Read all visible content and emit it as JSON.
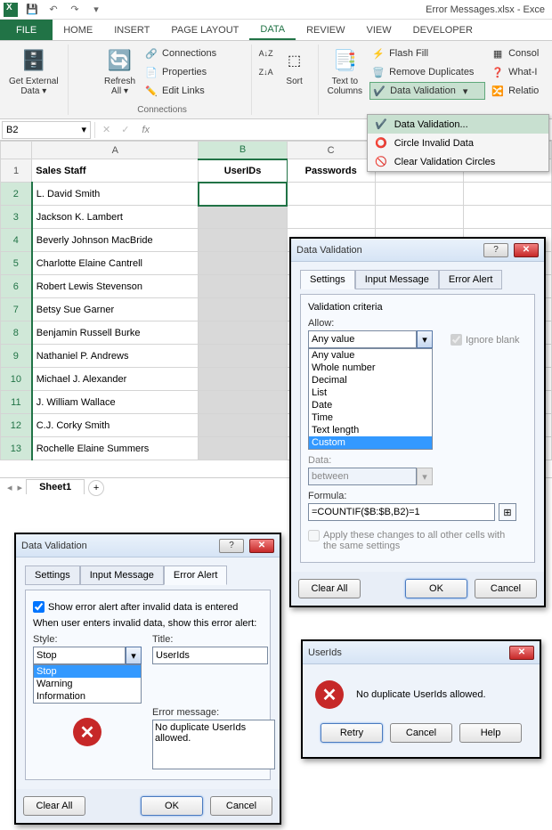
{
  "app": {
    "title": "Error Messages.xlsx - Exce"
  },
  "qat": {
    "save": "💾",
    "undo": "↶",
    "redo": "↷"
  },
  "tabs": {
    "file": "FILE",
    "home": "HOME",
    "insert": "INSERT",
    "pagelayout": "PAGE LAYOUT",
    "data": "DATA",
    "review": "REVIEW",
    "view": "VIEW",
    "developer": "DEVELOPER"
  },
  "ribbon": {
    "getexternal": "Get External\nData ▾",
    "refresh": "Refresh\nAll ▾",
    "connections_group": "Connections",
    "connections": "Connections",
    "properties": "Properties",
    "editlinks": "Edit Links",
    "sort": "Sort",
    "texttocol": "Text to\nColumns",
    "flashfill": "Flash Fill",
    "removedup": "Remove Duplicates",
    "datavalidation": "Data Validation",
    "consol": "Consol",
    "whatif": "What-I",
    "relation": "Relatio"
  },
  "dvmenu": {
    "dv": "Data Validation...",
    "circle": "Circle Invalid Data",
    "clear": "Clear Validation Circles"
  },
  "namebox": "B2",
  "sheet": {
    "headers": {
      "A": "Sales Staff",
      "B": "UserIDs",
      "C": "Passwords"
    },
    "rows": [
      "L. David Smith",
      "Jackson K. Lambert",
      "Beverly Johnson MacBride",
      "Charlotte Elaine Cantrell",
      "Robert Lewis Stevenson",
      "Betsy Sue Garner",
      "Benjamin Russell Burke",
      "Nathaniel P. Andrews",
      "Michael J. Alexander",
      "J. William Wallace",
      "C.J. Corky Smith",
      "Rochelle Elaine Summers"
    ],
    "tabname": "Sheet1"
  },
  "dlgSettings": {
    "title": "Data Validation",
    "tabs": {
      "settings": "Settings",
      "inputmsg": "Input Message",
      "erroralert": "Error Alert"
    },
    "criteria": "Validation criteria",
    "allow": "Allow:",
    "ignoreblank": "Ignore blank",
    "allow_value": "Any value",
    "options": [
      "Any value",
      "Whole number",
      "Decimal",
      "List",
      "Date",
      "Time",
      "Text length",
      "Custom"
    ],
    "data": "Data:",
    "data_value": "between",
    "formula": "Formula:",
    "formula_value": "=COUNTIF($B:$B,B2)=1",
    "apply": "Apply these changes to all other cells with the same settings",
    "clearall": "Clear All",
    "ok": "OK",
    "cancel": "Cancel"
  },
  "dlgErrorAlert": {
    "title": "Data Validation",
    "showerr": "Show error alert after invalid data is entered",
    "whenuser": "When user enters invalid data, show this error alert:",
    "style": "Style:",
    "style_value": "Stop",
    "style_opts": [
      "Stop",
      "Warning",
      "Information"
    ],
    "title_lbl": "Title:",
    "title_value": "UserIds",
    "errmsg_lbl": "Error message:",
    "errmsg_value": "No duplicate UserIds allowed.",
    "clearall": "Clear All",
    "ok": "OK",
    "cancel": "Cancel"
  },
  "dlgMsg": {
    "title": "UserIds",
    "text": "No duplicate UserIds allowed.",
    "retry": "Retry",
    "cancel": "Cancel",
    "help": "Help"
  }
}
